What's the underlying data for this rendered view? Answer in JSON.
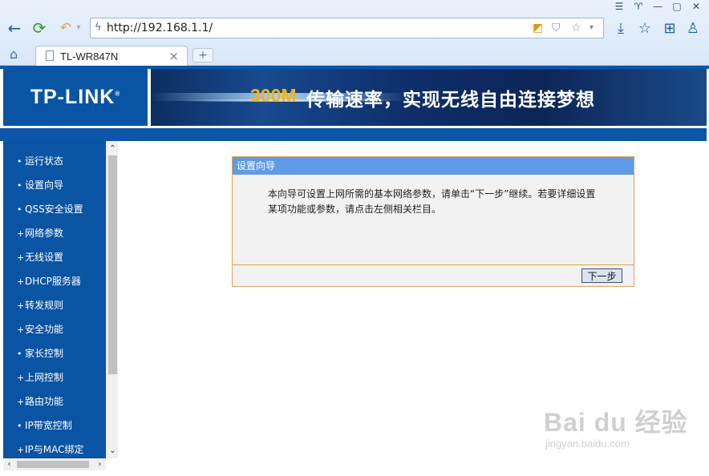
{
  "browser": {
    "address": "http://192.168.1.1/",
    "tab_title": "TL-WR847N",
    "new_tab_label": "+",
    "tab_close": "×"
  },
  "header": {
    "logo": "TP-LINK",
    "logo_mark": "®",
    "banner_highlight": "300M",
    "banner_text": "传输速率，实现无线自由连接梦想"
  },
  "sidebar": {
    "items": [
      {
        "bullet": "•",
        "label": "运行状态"
      },
      {
        "bullet": "•",
        "label": "设置向导"
      },
      {
        "bullet": "•",
        "label": "QSS安全设置"
      },
      {
        "bullet": "+",
        "label": "网络参数"
      },
      {
        "bullet": "+",
        "label": "无线设置"
      },
      {
        "bullet": "+",
        "label": "DHCP服务器"
      },
      {
        "bullet": "+",
        "label": "转发规则"
      },
      {
        "bullet": "+",
        "label": "安全功能"
      },
      {
        "bullet": "•",
        "label": "家长控制"
      },
      {
        "bullet": "+",
        "label": "上网控制"
      },
      {
        "bullet": "+",
        "label": "路由功能"
      },
      {
        "bullet": "•",
        "label": "IP带宽控制"
      },
      {
        "bullet": "+",
        "label": "IP与MAC绑定"
      }
    ]
  },
  "wizard": {
    "title": "设置向导",
    "description": "本向导可设置上网所需的基本网络参数，请单击“下一步”继续。若要详细设置某项功能或参数，请点击左侧相关栏目。",
    "next_button": "下一步"
  },
  "watermark": {
    "brand": "Bai du 经验",
    "url": "jingyan.baidu.com"
  },
  "colors": {
    "router_blue": "#0a54a4",
    "panel_header": "#5f9be6",
    "panel_border": "#e0a35a",
    "banner_accent": "#ffb200"
  }
}
